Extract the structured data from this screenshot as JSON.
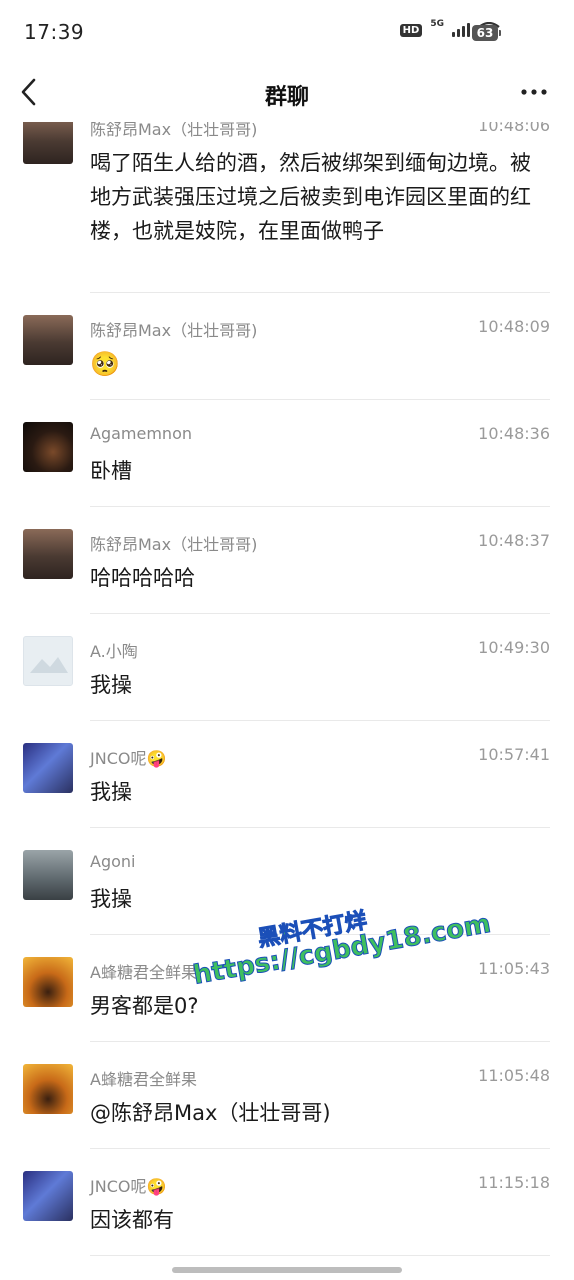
{
  "status_bar": {
    "time": "17:39",
    "hd": "HD",
    "network": "5G",
    "battery": "63"
  },
  "header": {
    "title": "群聊"
  },
  "messages": [
    {
      "sender": "陈舒昂Max（壮壮哥哥)",
      "time": "10:48:06",
      "text": "喝了陌生人给的酒，然后被绑架到缅甸边境。被地方武装强压过境之后被卖到电诈园区里面的红楼，也就是妓院，在里面做鸭子",
      "avatar": "person-avatar"
    },
    {
      "sender": "陈舒昂Max（壮壮哥哥)",
      "time": "10:48:09",
      "text": "🥺",
      "avatar": "person-avatar"
    },
    {
      "sender": "Agamemnon",
      "time": "10:48:36",
      "text": "卧槽",
      "avatar": "dark-avatar"
    },
    {
      "sender": "陈舒昂Max（壮壮哥哥)",
      "time": "10:48:37",
      "text": "哈哈哈哈哈",
      "avatar": "person-avatar"
    },
    {
      "sender": "A.小陶",
      "time": "10:49:30",
      "text": "我操",
      "avatar": "placeholder-avatar"
    },
    {
      "sender": "JNCO呢🤪",
      "time": "10:57:41",
      "text": "我操",
      "avatar": "anime-avatar"
    },
    {
      "sender": "Agoni",
      "time": "",
      "text": "我操",
      "avatar": "photo-avatar"
    },
    {
      "sender": "A蜂糖君全鲜果",
      "time": "11:05:43",
      "text": "男客都是0?",
      "avatar": "orange-avatar"
    },
    {
      "sender": "A蜂糖君全鲜果",
      "time": "11:05:48",
      "text": "@陈舒昂Max（壮壮哥哥)",
      "avatar": "orange-avatar"
    },
    {
      "sender": "JNCO呢🤪",
      "time": "11:15:18",
      "text": "因该都有",
      "avatar": "anime-avatar"
    }
  ],
  "watermark": {
    "line1": "黑料不打烊",
    "line2": "https://cgbdy18.com"
  }
}
